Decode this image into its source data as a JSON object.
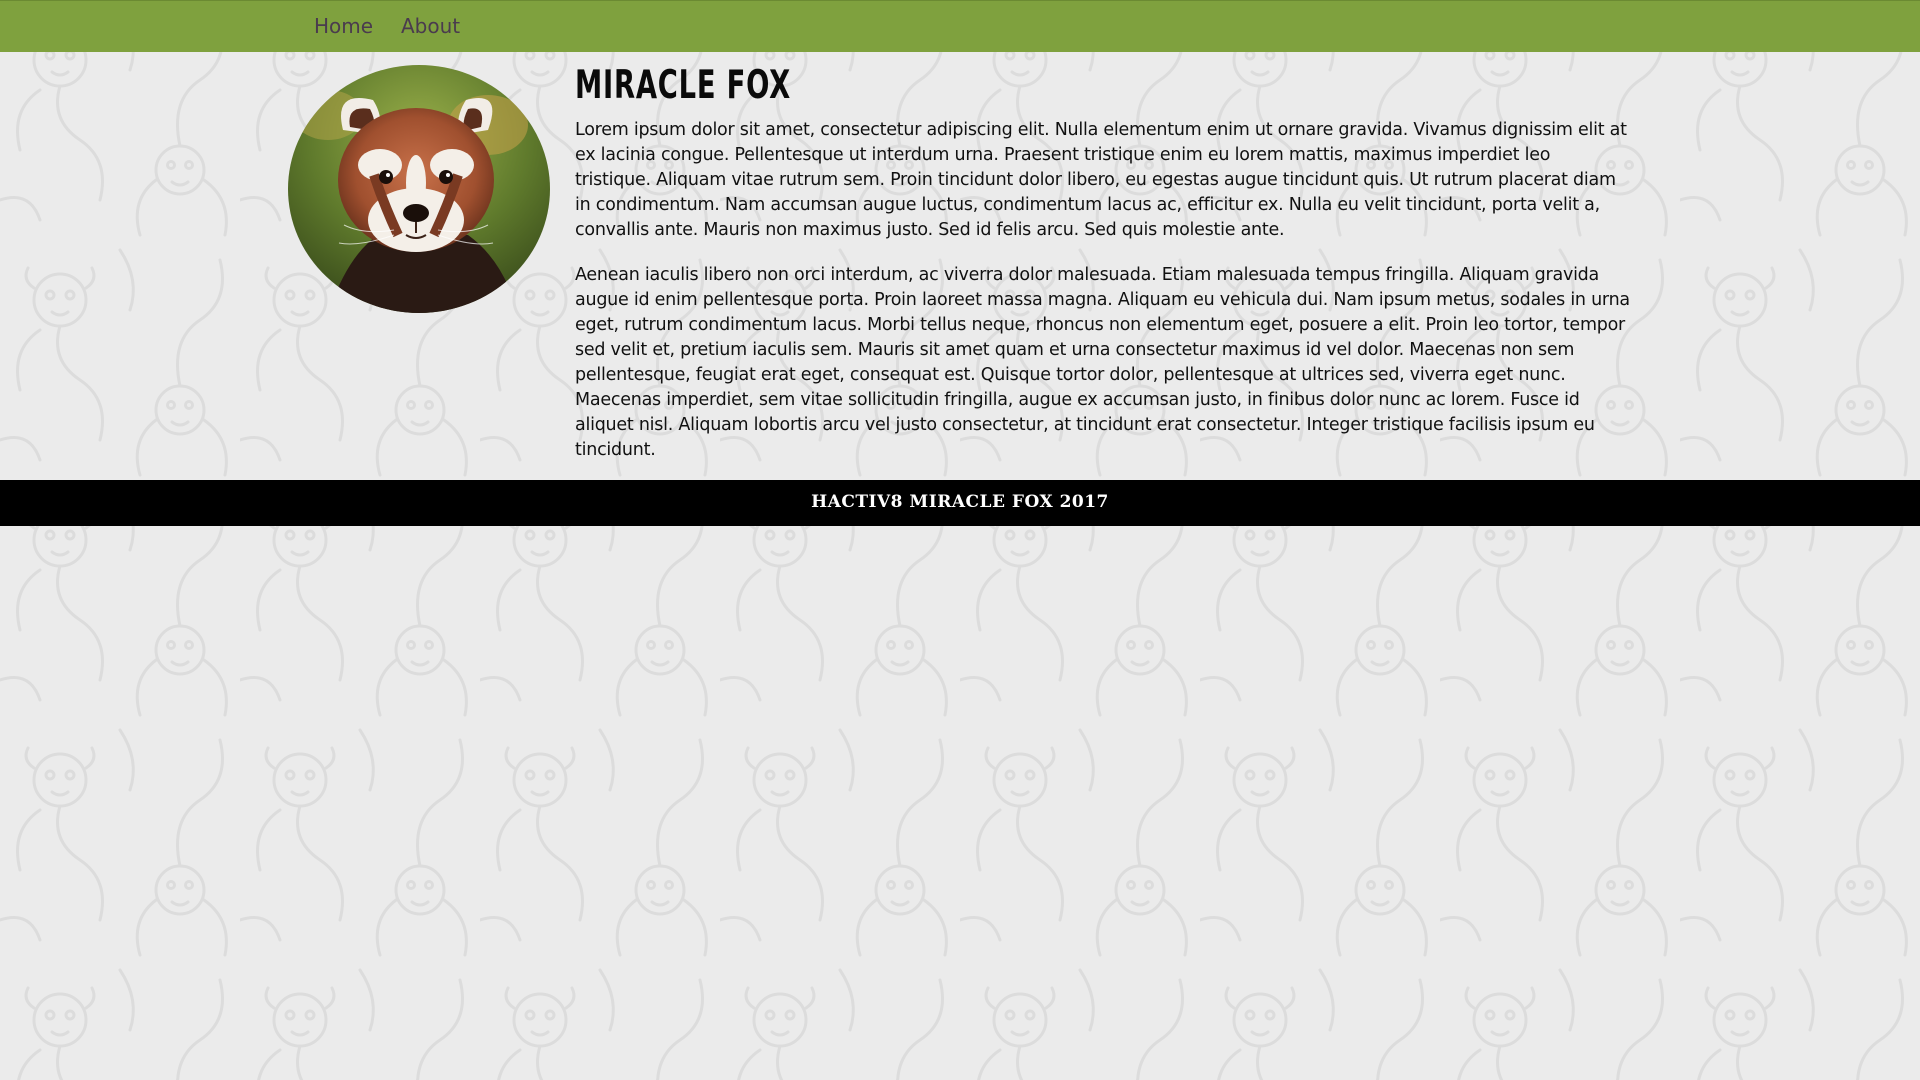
{
  "nav": {
    "items": [
      {
        "label": "Home"
      },
      {
        "label": "About"
      }
    ]
  },
  "profile": {
    "image": "red-panda-photo",
    "title": "MIRACLE FOX",
    "paragraphs": [
      "Lorem ipsum dolor sit amet, consectetur adipiscing elit. Nulla elementum enim ut ornare gravida. Vivamus dignissim elit at ex lacinia congue. Pellentesque ut interdum urna. Praesent tristique enim eu lorem mattis, maximus imperdiet leo tristique. Aliquam vitae rutrum sem. Proin tincidunt dolor libero, eu egestas augue tincidunt quis. Ut rutrum placerat diam in condimentum. Nam accumsan augue luctus, condimentum lacus ac, efficitur ex. Nulla eu velit tincidunt, porta velit a, convallis ante. Mauris non maximus justo. Sed id felis arcu. Sed quis molestie ante.",
      "Aenean iaculis libero non orci interdum, ac viverra dolor malesuada. Etiam malesuada tempus fringilla. Aliquam gravida augue id enim pellentesque porta. Proin laoreet massa magna. Aliquam eu vehicula dui. Nam ipsum metus, sodales in urna eget, rutrum condimentum lacus. Morbi tellus neque, rhoncus non elementum eget, posuere a elit. Proin leo tortor, tempor sed velit et, pretium iaculis sem. Mauris sit amet quam et urna consectetur maximus id vel dolor. Maecenas non sem pellentesque, feugiat erat eget, consequat est. Quisque tortor dolor, pellentesque at ultrices sed, viverra eget nunc. Maecenas imperdiet, sem vitae sollicitudin fringilla, augue ex accumsan justo, in finibus dolor nunc ac lorem. Fusce id aliquet nisl. Aliquam lobortis arcu vel justo consectetur, at tincidunt erat consectetur. Integer tristique facilisis ipsum eu tincidunt."
    ]
  },
  "footer": {
    "text": "HACTIV8 MIRACLE FOX 2017"
  },
  "colors": {
    "navbar": "#7fa13e",
    "background": "#ebebeb",
    "footer": "#000000",
    "nav_link": "#4a3b4e"
  }
}
